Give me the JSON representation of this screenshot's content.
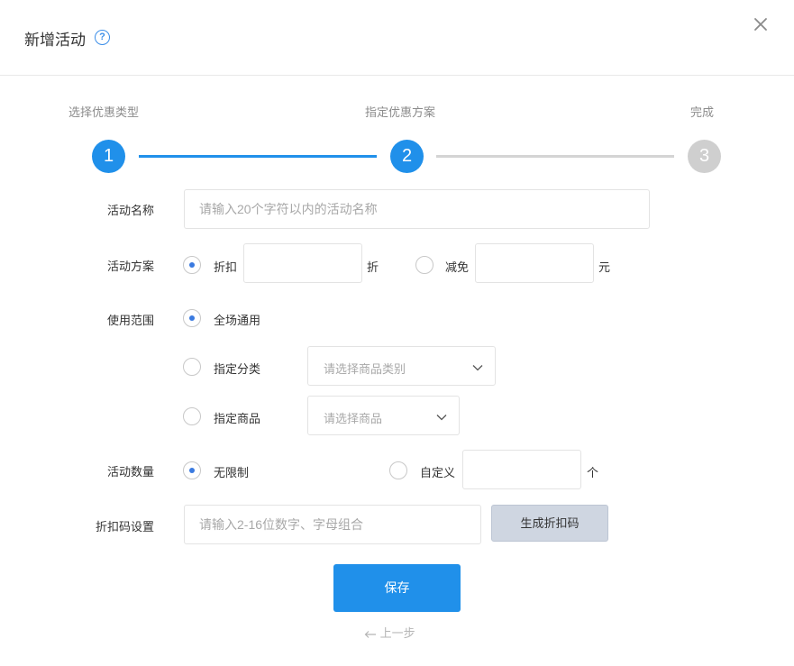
{
  "dialog": {
    "title": "新增活动",
    "help_icon": "question-circle-icon",
    "close_icon": "close-icon"
  },
  "steps": [
    {
      "label": "选择优惠类型",
      "number": "1",
      "state": "done"
    },
    {
      "label": "指定优惠方案",
      "number": "2",
      "state": "active"
    },
    {
      "label": "完成",
      "number": "3",
      "state": "todo"
    }
  ],
  "form": {
    "name": {
      "label": "活动名称",
      "placeholder": "请输入20个字符以内的活动名称",
      "value": ""
    },
    "plan": {
      "label": "活动方案",
      "discount_label": "折扣",
      "discount_unit": "折",
      "discount_checked": true,
      "reduce_label": "减免",
      "reduce_unit": "元",
      "reduce_checked": false
    },
    "scope": {
      "label": "使用范围",
      "all_label": "全场通用",
      "all_checked": true,
      "category_label": "指定分类",
      "category_placeholder": "请选择商品类别",
      "product_label": "指定商品",
      "product_placeholder": "请选择商品"
    },
    "quantity": {
      "label": "活动数量",
      "unlimited_label": "无限制",
      "unlimited_checked": true,
      "custom_label": "自定义",
      "custom_unit": "个"
    },
    "code": {
      "label": "折扣码设置",
      "placeholder": "请输入2-16位数字、字母组合",
      "generate_label": "生成折扣码"
    }
  },
  "actions": {
    "save_label": "保存",
    "back_label": "上一步",
    "back_icon": "arrow-left-icon"
  },
  "colors": {
    "primary": "#2090ea",
    "inactive": "#cfcfcf",
    "radio_dot": "#3a7ae0"
  }
}
